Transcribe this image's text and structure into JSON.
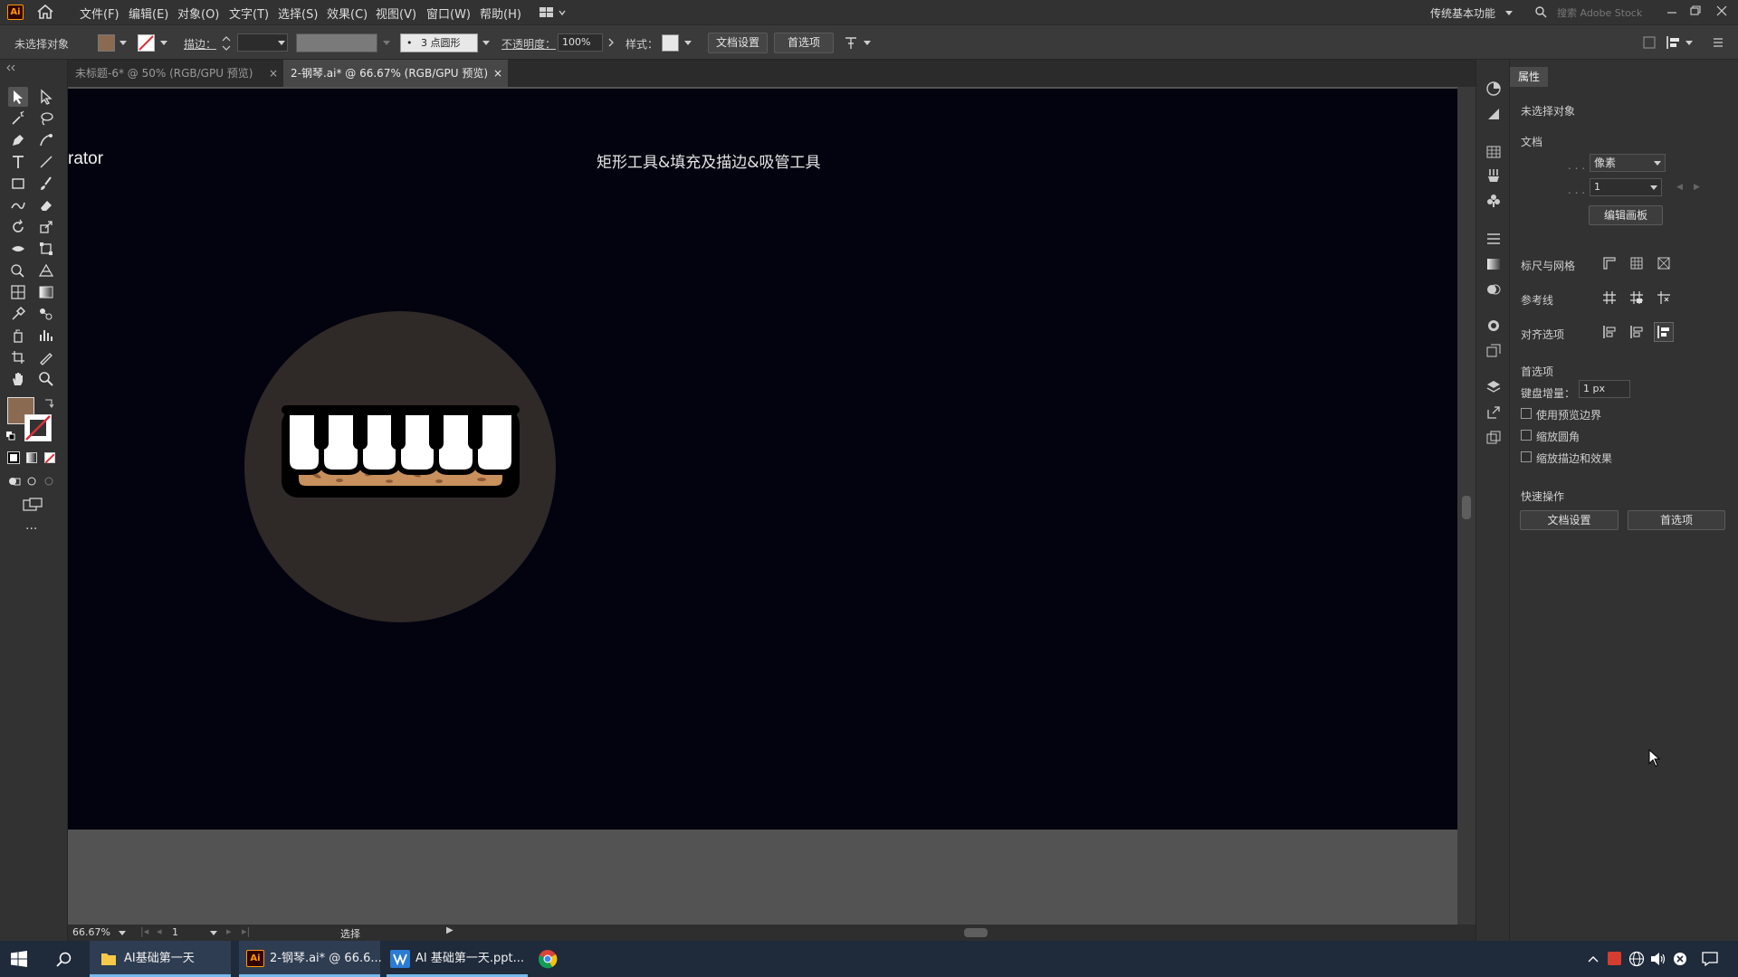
{
  "menubar": {
    "app_logo": "Ai",
    "menus": [
      "文件(F)",
      "编辑(E)",
      "对象(O)",
      "文字(T)",
      "选择(S)",
      "效果(C)",
      "视图(V)",
      "窗口(W)",
      "帮助(H)"
    ],
    "workspace": "传统基本功能",
    "search_placeholder": "搜索 Adobe Stock"
  },
  "controlbar": {
    "selection_state": "未选择对象",
    "stroke_label": "描边：",
    "brush_label": "3 点圆形",
    "opacity_label": "不透明度：",
    "opacity_value": "100%",
    "style_label": "样式：",
    "doc_setup_button": "文档设置",
    "prefs_button": "首选项",
    "colors": {
      "fill": "#8a6b52",
      "stroke": "#d8313a"
    }
  },
  "tabs": [
    {
      "label": "未标题-6* @ 50% (RGB/GPU 预览)",
      "active": false
    },
    {
      "label": "2-钢琴.ai* @ 66.67% (RGB/GPU 预览)",
      "active": true
    }
  ],
  "artboard": {
    "partial_text": "rator",
    "title": "矩形工具&填充及描边&吸管工具",
    "colors": {
      "background": "#03020f",
      "circle": "#2f2927",
      "keys": "#ffffff",
      "outline": "#000000",
      "base": "#c8905d",
      "speckle": "#8c5a35"
    }
  },
  "status": {
    "zoom": "66.67%",
    "page": "1",
    "tool": "选择"
  },
  "properties": {
    "panel_title": "属性",
    "selection_state": "未选择对象",
    "document_section": "文档",
    "units_value": "像素",
    "artboard_value": "1",
    "edit_artboards_button": "编辑画板",
    "rulers_grid_label": "标尺与网格",
    "guides_label": "参考线",
    "align_options_label": "对齐选项",
    "preferences_section": "首选项",
    "keyboard_increment_label": "键盘增量：",
    "keyboard_increment_value": "1 px",
    "checkboxes": [
      "使用预览边界",
      "缩放圆角",
      "缩放描边和效果"
    ],
    "quick_actions_section": "快速操作",
    "doc_setup_button": "文档设置",
    "prefs_button": "首选项"
  },
  "taskbar": {
    "items": [
      {
        "label": "AI基础第一天",
        "icon": "folder-icon"
      },
      {
        "label": "2-钢琴.ai* @ 66.6...",
        "icon": "illustrator-icon"
      },
      {
        "label": "AI 基础第一天.ppt...",
        "icon": "presentation-icon"
      }
    ],
    "browser": "chrome-icon"
  }
}
